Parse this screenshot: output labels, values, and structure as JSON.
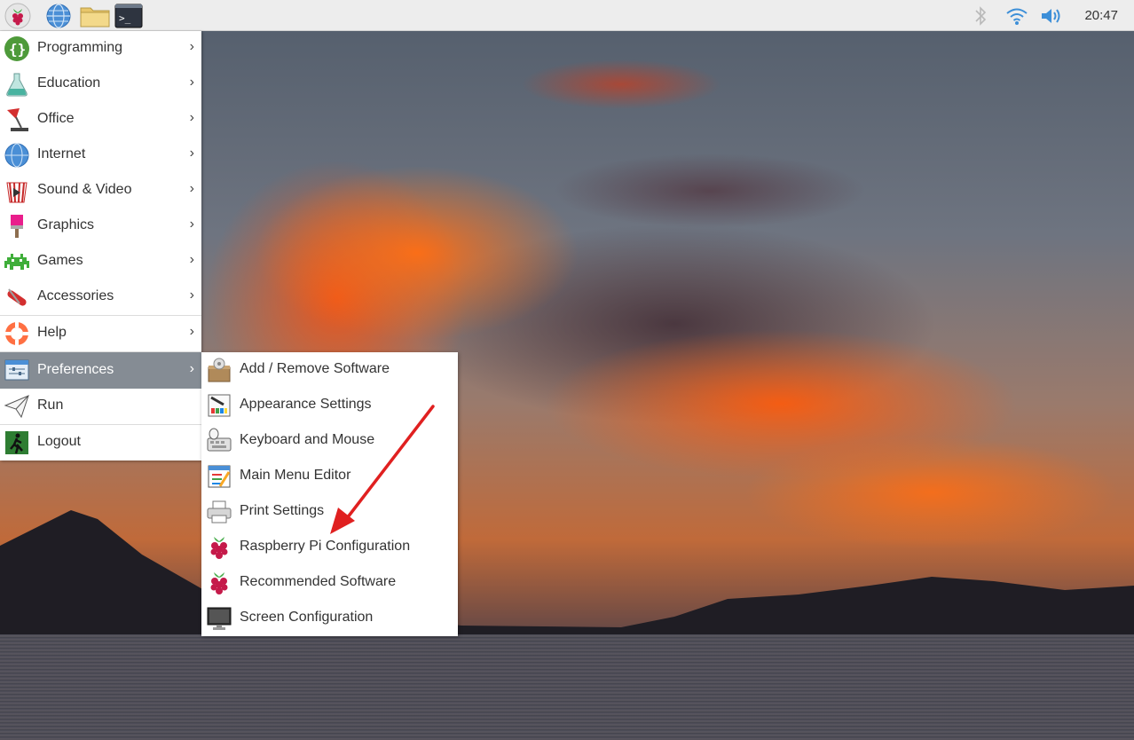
{
  "taskbar": {
    "launchers": [
      "raspberry-menu-icon",
      "web-browser-icon",
      "file-manager-icon",
      "terminal-icon"
    ],
    "tray": [
      "bluetooth-icon",
      "wifi-icon",
      "volume-icon"
    ],
    "clock": "20:47"
  },
  "main_menu": {
    "items": [
      {
        "label": "Programming",
        "icon": "programming-icon",
        "submenu": true
      },
      {
        "label": "Education",
        "icon": "education-icon",
        "submenu": true
      },
      {
        "label": "Office",
        "icon": "office-icon",
        "submenu": true
      },
      {
        "label": "Internet",
        "icon": "internet-icon",
        "submenu": true
      },
      {
        "label": "Sound & Video",
        "icon": "sound-video-icon",
        "submenu": true
      },
      {
        "label": "Graphics",
        "icon": "graphics-icon",
        "submenu": true
      },
      {
        "label": "Games",
        "icon": "games-icon",
        "submenu": true
      },
      {
        "label": "Accessories",
        "icon": "accessories-icon",
        "submenu": true
      },
      {
        "label": "Help",
        "icon": "help-icon",
        "submenu": true
      },
      {
        "label": "Preferences",
        "icon": "preferences-icon",
        "submenu": true,
        "active": true
      },
      {
        "label": "Run",
        "icon": "run-icon",
        "submenu": false
      },
      {
        "label": "Logout",
        "icon": "logout-icon",
        "submenu": false
      }
    ],
    "arrow_glyph": "›"
  },
  "preferences_submenu": {
    "items": [
      {
        "label": "Add / Remove Software",
        "icon": "package-icon"
      },
      {
        "label": "Appearance Settings",
        "icon": "appearance-icon"
      },
      {
        "label": "Keyboard and Mouse",
        "icon": "keyboard-mouse-icon"
      },
      {
        "label": "Main Menu Editor",
        "icon": "menu-editor-icon"
      },
      {
        "label": "Print Settings",
        "icon": "printer-icon"
      },
      {
        "label": "Raspberry Pi Configuration",
        "icon": "raspberry-icon"
      },
      {
        "label": "Recommended Software",
        "icon": "raspberry-icon"
      },
      {
        "label": "Screen Configuration",
        "icon": "monitor-icon"
      }
    ]
  },
  "colors": {
    "panel_bg": "#ededed",
    "menu_bg": "#ffffff",
    "active_item_bg": "#858c94",
    "annotation_arrow": "#e02020",
    "raspberry_red": "#c51a4a"
  }
}
